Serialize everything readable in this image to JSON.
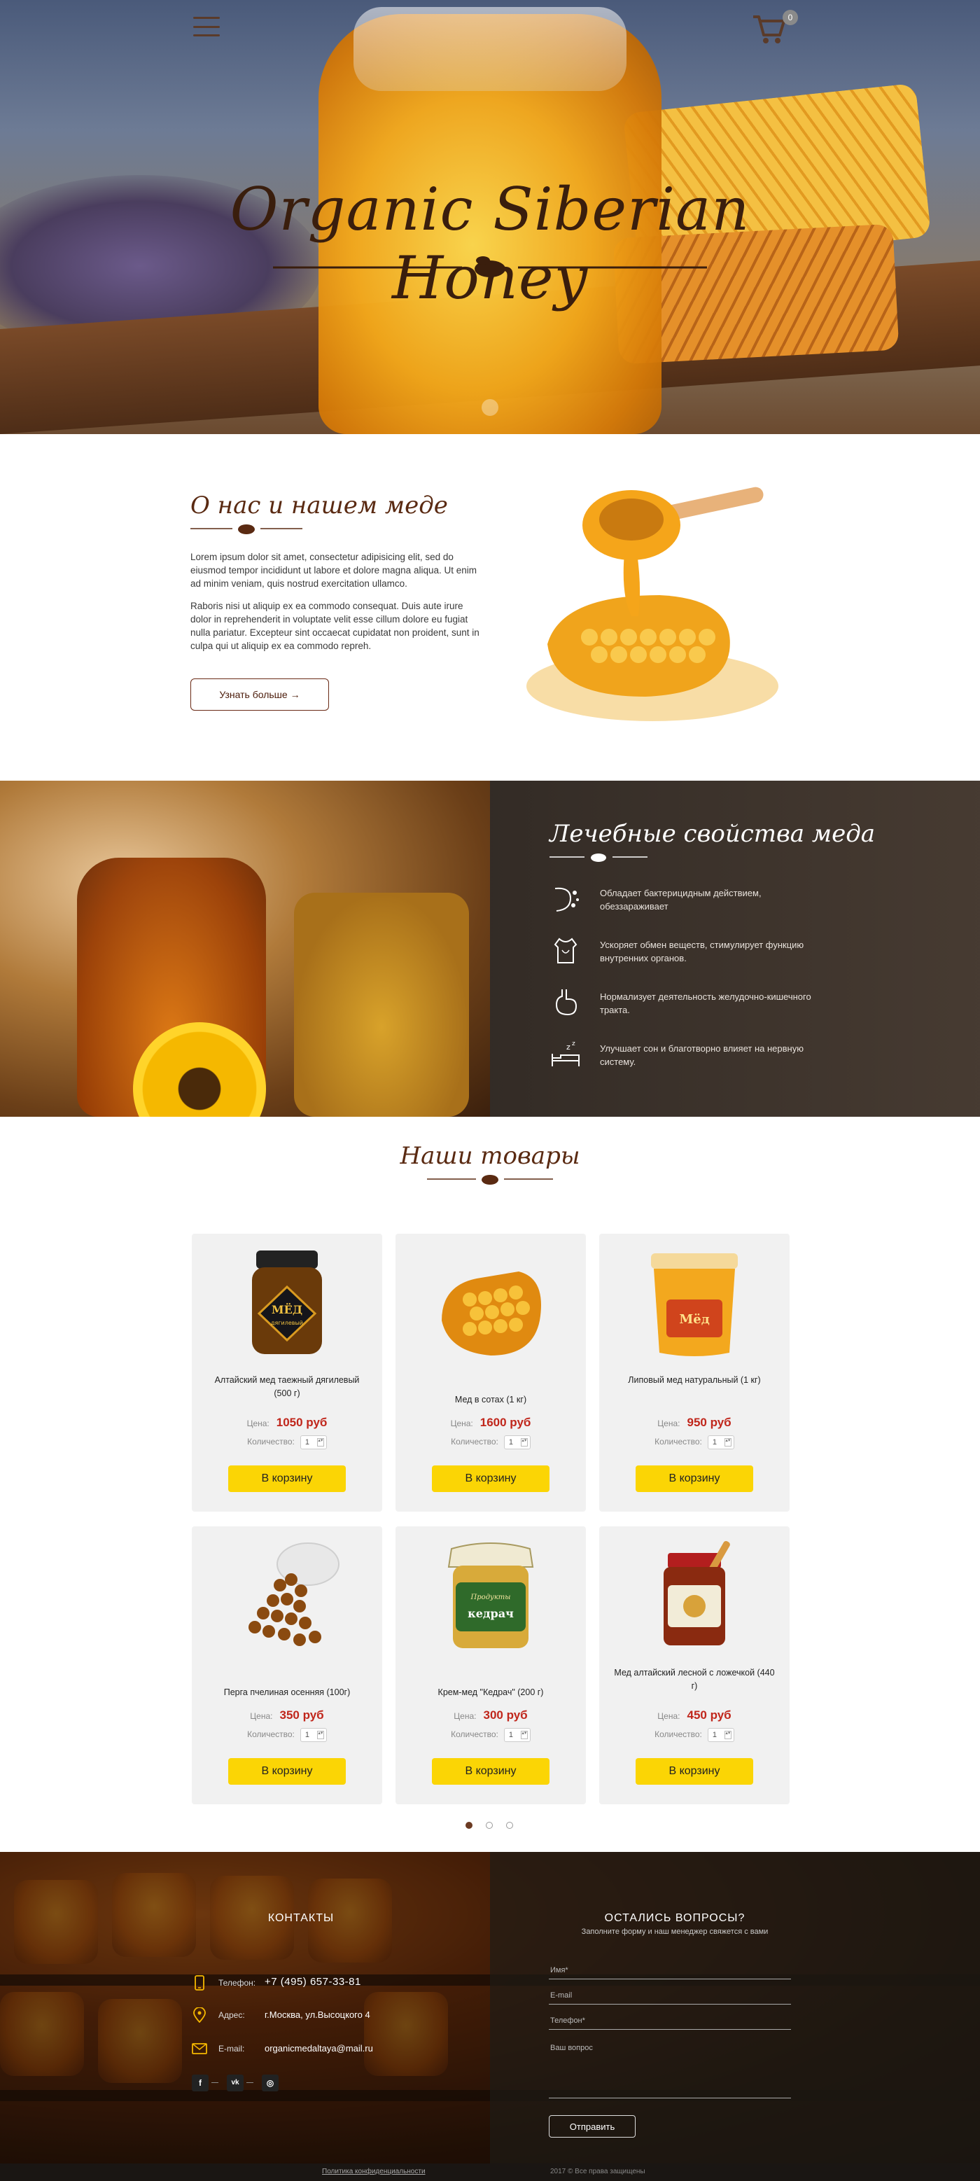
{
  "hero": {
    "title": "Organic Siberian Honey",
    "cart_count": "0"
  },
  "about": {
    "title": "О нас и нашем меде",
    "paragraph1": "Lorem ipsum dolor sit amet, consectetur adipisicing elit, sed do eiusmod tempor incididunt ut labore et dolore magna aliqua. Ut enim ad minim veniam, quis nostrud exercitation ullamco.",
    "paragraph2": "Raboris nisi ut aliquip ex ea commodo consequat. Duis aute irure dolor in reprehenderit in voluptate velit esse cillum dolore eu fugiat nulla pariatur. Excepteur sint occaecat cupidatat non proident, sunt in culpa qui ut aliquip ex ea commodo repreh.",
    "button": "Узнать больше →"
  },
  "properties": {
    "title": "Лечебные свойства меда",
    "items": [
      {
        "icon": "bacteria-icon",
        "text": "Обладает бактерицидным действием, обеззараживает"
      },
      {
        "icon": "body-icon",
        "text": "Ускоряет обмен веществ, стимулирует функцию внутренних органов."
      },
      {
        "icon": "stomach-icon",
        "text": "Нормализует деятельность желудочно-кишечного тракта."
      },
      {
        "icon": "sleep-icon",
        "text": "Улучшает сон и благотворно влияет на нервную систему."
      }
    ]
  },
  "products": {
    "title": "Наши товары",
    "price_label": "Цена:",
    "qty_label": "Количество:",
    "cart_label": "В корзину",
    "items": [
      {
        "name": "Алтайский мед таежный дягилевый (500 г)",
        "price": "1050 руб",
        "qty": "1"
      },
      {
        "name": "Мед в сотах (1 кг)",
        "price": "1600 руб",
        "qty": "1"
      },
      {
        "name": "Липовый мед натуральный (1 кг)",
        "price": "950 руб",
        "qty": "1"
      },
      {
        "name": "Перга пчелиная осенняя (100г)",
        "price": "350 руб",
        "qty": "1"
      },
      {
        "name": "Крем-мед \"Кедрач\" (200 г)",
        "price": "300 руб",
        "qty": "1"
      },
      {
        "name": "Мед алтайский лесной с ложечкой (440 г)",
        "price": "450 руб",
        "qty": "1"
      }
    ],
    "jar1_label": "МЁД",
    "jar1_sublabel": "дягилевый",
    "jar3_label": "Мёд",
    "jar5_label": "кедрач",
    "jar5_top": "Продукты",
    "pager": {
      "pages": 3,
      "active": 1
    }
  },
  "contacts": {
    "title": "КОНТАКТЫ",
    "phone_label": "Телефон:",
    "phone": "+7 (495) 657-33-81",
    "address_label": "Адрес:",
    "address": "г.Москва, ул.Высоцкого 4",
    "email_label": "E-mail:",
    "email": "organicmedaltaya@mail.ru",
    "socials": [
      "f",
      "vk",
      "ig"
    ]
  },
  "form": {
    "title": "ОСТАЛИСЬ ВОПРОСЫ?",
    "subtitle": "Заполните форму и наш менеджер свяжется с вами",
    "name_placeholder": "Имя*",
    "email_placeholder": "E-mail",
    "phone_placeholder": "Телефон*",
    "question_placeholder": "Ваш вопрос",
    "send": "Отправить"
  },
  "bottom": {
    "privacy": "Политика конфиденциальности",
    "copyright": "2017 © Все права защищены"
  },
  "colors": {
    "accent": "#fbd505",
    "brand": "#5a2a12",
    "price": "#c0261b"
  }
}
